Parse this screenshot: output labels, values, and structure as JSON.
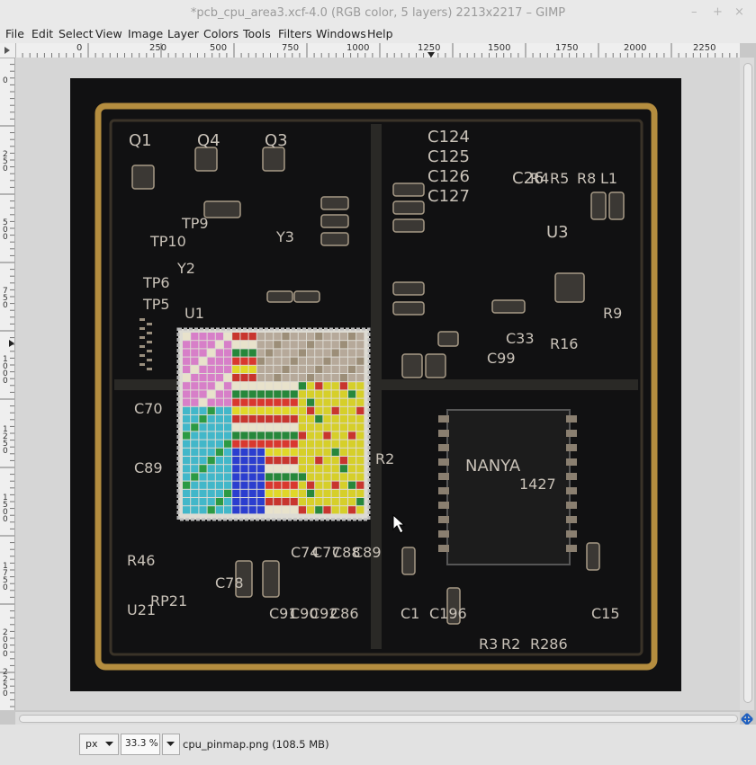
{
  "window": {
    "title": "*pcb_cpu_area3.xcf-4.0 (RGB color, 5 layers) 2213x2217 – GIMP",
    "minimize": "–",
    "maximize": "+",
    "close": "×"
  },
  "menu": [
    "File",
    "Edit",
    "Select",
    "View",
    "Image",
    "Layer",
    "Colors",
    "Tools",
    "Filters",
    "Windows",
    "Help"
  ],
  "ruler": {
    "h_labels": [
      "0",
      "250",
      "0",
      "500",
      "750",
      "1000",
      "1250",
      "1500",
      "1750",
      "2000",
      "2250"
    ],
    "v_labels": [
      "0",
      "2\n5\n0",
      "5\n0\n0",
      "7\n5\n0",
      "1\n0\n0\n0",
      "1\n2\n5\n0",
      "1\n5\n0\n0",
      "1\n7\n5\n0",
      "2\n0\n0\n0",
      "2\n2\n5\n0"
    ]
  },
  "pcb": {
    "labels": [
      "Q1",
      "Q4",
      "Q3",
      "TP10",
      "TP9",
      "Y3",
      "Y2",
      "TP6",
      "TP5",
      "U1",
      "C124",
      "C125",
      "C126",
      "C127",
      "C26",
      "R4",
      "R5",
      "R8",
      "L1",
      "U3",
      "R9",
      "C33",
      "R16",
      "C70",
      "C89",
      "R2",
      "R46",
      "U21",
      "RP21",
      "C78",
      "C91",
      "C90",
      "C92",
      "C86",
      "C74",
      "C77",
      "C88",
      "C89",
      "C1",
      "C196",
      "R3",
      "R2",
      "R286",
      "C15",
      "C99",
      "NANYA",
      "1427"
    ]
  },
  "status": {
    "unit": "px",
    "zoom": "33.3 %",
    "file_info": "cpu_pinmap.png (108.5 MB)"
  },
  "colors": {
    "board_bg": "#111112",
    "gold_trace": "#b48d3f",
    "silkscreen": "#c9c2b8",
    "selection_bg": "#dddbd3"
  }
}
